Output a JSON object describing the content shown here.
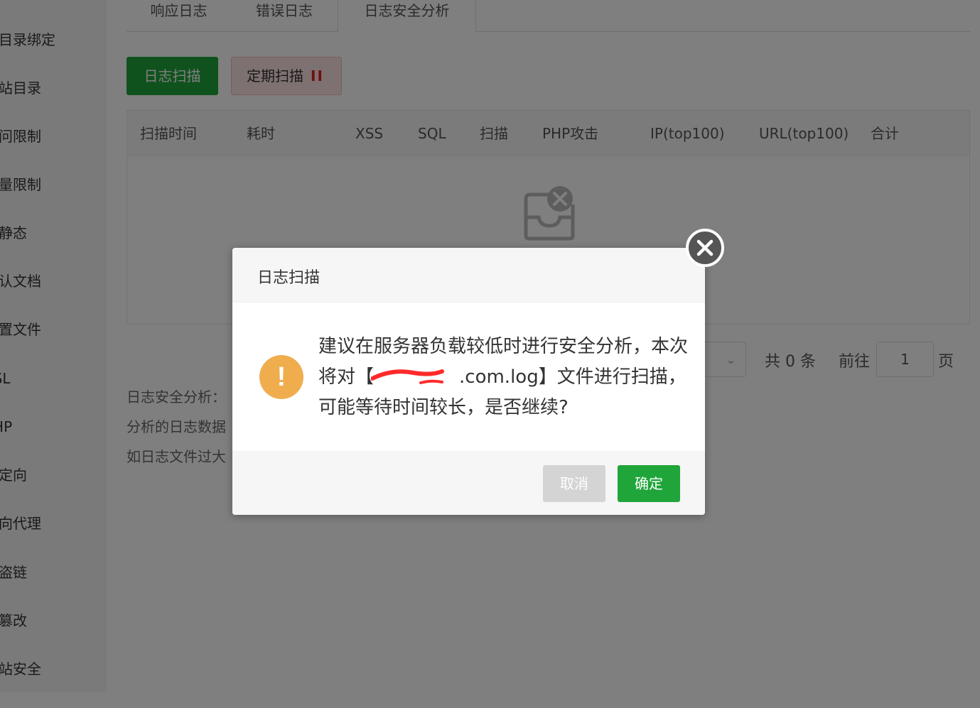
{
  "sidebar": {
    "items": [
      {
        "label": "子目录绑定"
      },
      {
        "label": "网站目录"
      },
      {
        "label": "访问限制"
      },
      {
        "label": "流量限制"
      },
      {
        "label": "伪静态"
      },
      {
        "label": "默认文档"
      },
      {
        "label": "配置文件"
      },
      {
        "label": "SSL"
      },
      {
        "label": "PHP"
      },
      {
        "label": "重定向"
      },
      {
        "label": "反向代理"
      },
      {
        "label": "防盗链"
      },
      {
        "label": "防篡改"
      },
      {
        "label": "网站安全"
      }
    ]
  },
  "tabs": [
    {
      "label": "响应日志"
    },
    {
      "label": "错误日志"
    },
    {
      "label": "日志安全分析",
      "active": true
    }
  ],
  "toolbar": {
    "scan_label": "日志扫描",
    "periodic_label": "定期扫描",
    "periodic_pause": "II"
  },
  "table": {
    "columns": [
      "扫描时间",
      "耗时",
      "XSS",
      "SQL",
      "扫描",
      "PHP攻击",
      "IP(top100)",
      "URL(top100)",
      "合计"
    ],
    "rows": []
  },
  "pagination": {
    "total": "共 0 条",
    "goto_label": "前往",
    "page_value": "1",
    "page_suffix": "页"
  },
  "notes": [
    "日志安全分析：",
    "分析的日志数据",
    "如日志文件过大"
  ],
  "dialog": {
    "title": "日志扫描",
    "message_part1": "建议在服务器负载较低时进行安全分析，本次将对【",
    "message_part2": ".com.log】文件进行扫描，可能等待时间较长，是否继续?",
    "cancel_label": "取消",
    "ok_label": "确定"
  },
  "colors": {
    "primary": "#20a53a",
    "warning": "#f0ad4e",
    "danger": "#e02020"
  }
}
